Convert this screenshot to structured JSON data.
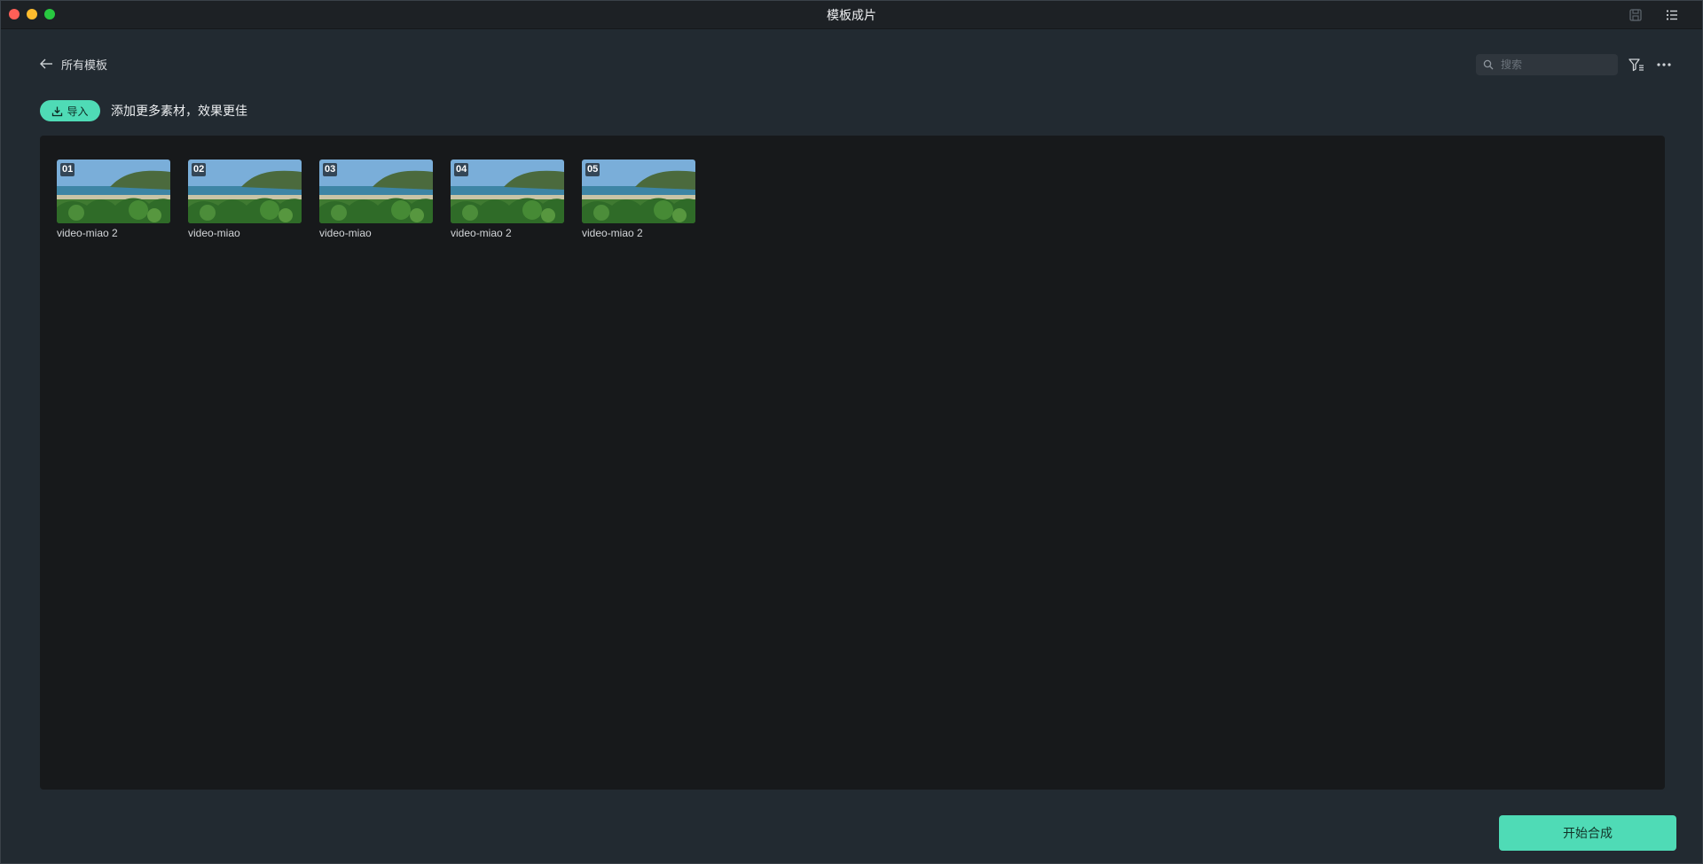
{
  "window": {
    "title": "模板成片",
    "icons": [
      "save-icon",
      "list-icon"
    ]
  },
  "header": {
    "back_label": "所有模板",
    "back_icon": "arrow-left-icon",
    "search_placeholder": "搜索",
    "search_value": "",
    "filter_icon": "filter-icon",
    "more_icon": "more-horizontal-icon"
  },
  "toolbar": {
    "import_label": "导入",
    "import_icon": "import-download-icon",
    "hint": "添加更多素材，效果更佳"
  },
  "clips": [
    {
      "index": "01",
      "name": "video-miao 2"
    },
    {
      "index": "02",
      "name": "video-miao"
    },
    {
      "index": "03",
      "name": "video-miao"
    },
    {
      "index": "04",
      "name": "video-miao 2"
    },
    {
      "index": "05",
      "name": "video-miao 2"
    }
  ],
  "footer": {
    "start_label": "开始合成"
  },
  "colors": {
    "accent": "#4fdbb6",
    "background": "#222a31",
    "panel": "#17191b",
    "titlebar": "#1d2125"
  }
}
